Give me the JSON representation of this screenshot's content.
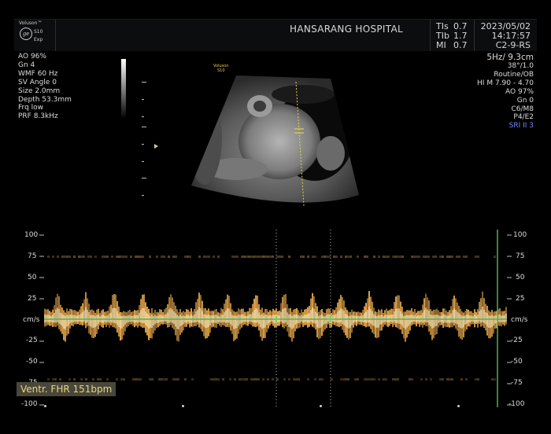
{
  "header": {
    "logo_brand": "Voluson™",
    "logo_mark": "ge",
    "logo_model": "S10",
    "logo_exp": "Exp",
    "hospital": "HANSARANG HOSPITAL",
    "tis_label": "TIs",
    "tis_value": "0.7",
    "tib_label": "TIb",
    "tib_value": "1.7",
    "mi_label": "MI",
    "mi_value": "0.7",
    "date": "2023/05/02",
    "time": "14:17:57",
    "probe": "C2-9-RS"
  },
  "left_params": [
    "AO 96%",
    "Gn 4",
    "WMF 60 Hz",
    "SV Angle 0",
    "Size 2.0mm",
    "Depth 53.3mm",
    "Frq low",
    "PRF 8.3kHz"
  ],
  "right_params": {
    "freq_depth": "5Hz/ 9.3cm",
    "lines": [
      "38°/1.0",
      "Routine/OB",
      "HI M 7.90 - 4.70",
      "AO 97%",
      "Gn 0",
      "C6/M8",
      "P4/E2"
    ],
    "sri": "SRI II 3"
  },
  "bmode_tag": {
    "line1": "Voluson",
    "line2": "S10"
  },
  "doppler": {
    "scale_labels": [
      "100",
      "75",
      "50",
      "25",
      "cm/s",
      "-25",
      "-50",
      "-75",
      "-100"
    ],
    "unit": "cm/s",
    "fhr_label": "Ventr. FHR 151bpm"
  },
  "colors": {
    "accent_yellow": "#e9d57a",
    "doppler_gold": "#e8a84a",
    "baseline_green": "#4fb34f",
    "sri_blue": "#7b86ff"
  }
}
